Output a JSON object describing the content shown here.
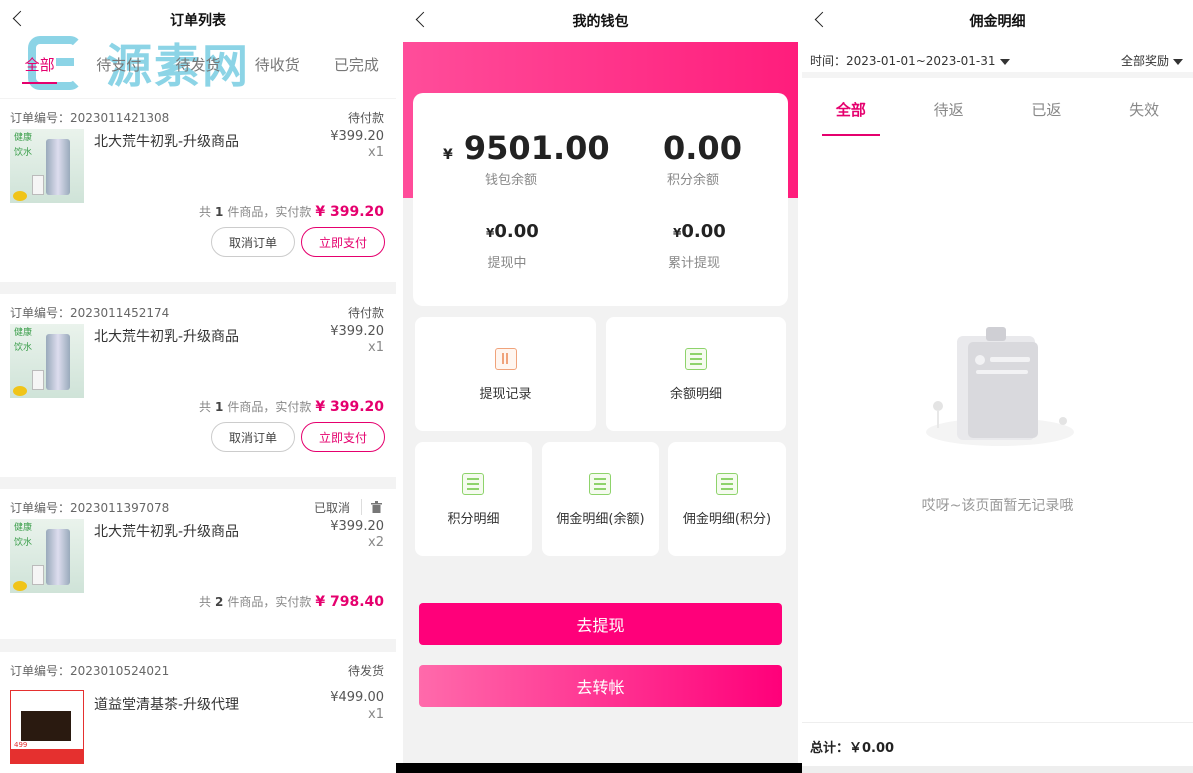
{
  "order_list": {
    "title": "订单列表",
    "watermark": "源素网",
    "tabs": [
      "全部",
      "待支付",
      "待发货",
      "待收货",
      "已完成"
    ],
    "orders": [
      {
        "no_label": "订单编号：2023011421308",
        "status": "待付款",
        "name": "北大荒牛初乳-升级商品",
        "price": "¥399.20",
        "qty": "x1",
        "summary_pre": "共",
        "count": "1",
        "summary_mid": "件商品，实付款",
        "total": "¥ 399.20",
        "cancel": "取消订单",
        "pay": "立即支付"
      },
      {
        "no_label": "订单编号：2023011452174",
        "status": "待付款",
        "name": "北大荒牛初乳-升级商品",
        "price": "¥399.20",
        "qty": "x1",
        "summary_pre": "共",
        "count": "1",
        "summary_mid": "件商品，实付款",
        "total": "¥ 399.20",
        "cancel": "取消订单",
        "pay": "立即支付"
      },
      {
        "no_label": "订单编号：2023011397078",
        "status": "已取消",
        "name": "北大荒牛初乳-升级商品",
        "price": "¥399.20",
        "qty": "x2",
        "summary_pre": "共",
        "count": "2",
        "summary_mid": "件商品，实付款",
        "total": "¥ 798.40"
      },
      {
        "no_label": "订单编号：2023010524021",
        "status": "待发货",
        "name": "道益堂清基茶-升级代理",
        "price": "¥499.00",
        "qty": "x1"
      }
    ],
    "product_image_text": {
      "line1": "健康",
      "line2": "饮水",
      "tea_tag": "499"
    }
  },
  "wallet": {
    "title": "我的钱包",
    "currency": "¥",
    "balance": "9501.00",
    "balance_label": "钱包余额",
    "points": "0.00",
    "points_label": "积分余额",
    "withdrawing": "0.00",
    "withdrawing_label": "提现中",
    "total_withdrawn": "0.00",
    "total_withdrawn_label": "累计提现",
    "grid": [
      "提现记录",
      "余额明细",
      "积分明细",
      "佣金明细(余额)",
      "佣金明细(积分)"
    ],
    "withdraw_button": "去提现",
    "transfer_button": "去转帐"
  },
  "commission": {
    "title": "佣金明细",
    "date_label": "时间：2023-01-01~2023-01-31",
    "reward_filter": "全部奖励",
    "tabs": [
      "全部",
      "待返",
      "已返",
      "失效"
    ],
    "empty_text": "哎呀~该页面暂无记录哦",
    "total_label": "总计：￥0.00"
  },
  "colors": {
    "accent": "#e5006e",
    "pink": "#ff007a"
  }
}
